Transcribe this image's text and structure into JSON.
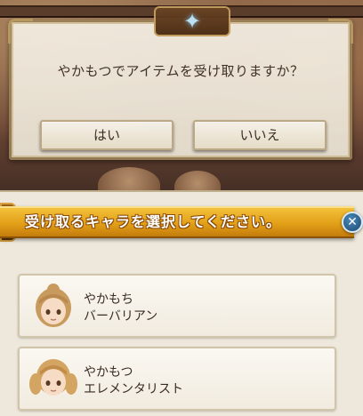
{
  "dialog": {
    "question": "やかもつでアイテムを受け取りますか？",
    "yes_label": "はい",
    "no_label": "いいえ",
    "crest_icon": "star-crest-icon"
  },
  "panel": {
    "title": "受け取るキャラを選択してください。",
    "close_icon": "close-icon",
    "accent_color": "#e2a018",
    "characters": [
      {
        "name": "やかもち",
        "class": "バーバリアン",
        "hair_color": "#c89a5e"
      },
      {
        "name": "やかもつ",
        "class": "エレメンタリスト",
        "hair_color": "#d4a462"
      }
    ]
  }
}
